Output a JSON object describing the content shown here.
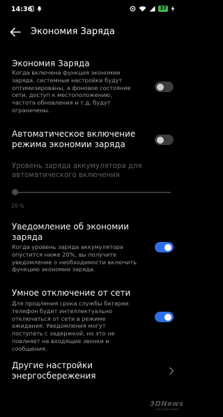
{
  "status_bar": {
    "time": "14:36",
    "battery": "37"
  },
  "header": {
    "title": "Экономия Заряда"
  },
  "battery_saver": {
    "title": "Экономия Заряда",
    "description": "Когда включена функция экономии заряда, системные настройки будут оптимизированы, а фоновое состояние сети, доступ к местоположению, частота обновления и т.д. будут ограничены.",
    "enabled": false
  },
  "auto_enable": {
    "title": "Автоматическое включение режима экономии заряда",
    "enabled": false
  },
  "battery_level": {
    "title": "Уровень заряда аккумулятора для автоматического включения",
    "value_text": "20 %",
    "value_percent": 20,
    "slider_fraction": 0
  },
  "saver_notification": {
    "title": "Уведомление об экономии заряда",
    "description": "Когда уровень заряда аккумулятора опустится ниже 20%, вы получите уведомление о необходимости включить функцию экономии заряда.",
    "enabled": true
  },
  "smart_network": {
    "title": "Умное отключение от сети",
    "description": "Для продления срока службы батареи телефон будет интеллектуально отключаться от сети в режиме ожидания. Уведомления могут поступать с задержкой, но это не повлияет на входящие звонки и сообщения.",
    "enabled": true
  },
  "other_settings": {
    "title": "Другие настройки энергосбережения"
  },
  "watermark": {
    "brand": "3DNews",
    "tagline": "Daily Digital Digest"
  },
  "colors": {
    "background": "#000000",
    "accent": "#2e6fe6",
    "toggle_off": "#3c3c3c",
    "battery_badge": "#3fb950"
  }
}
